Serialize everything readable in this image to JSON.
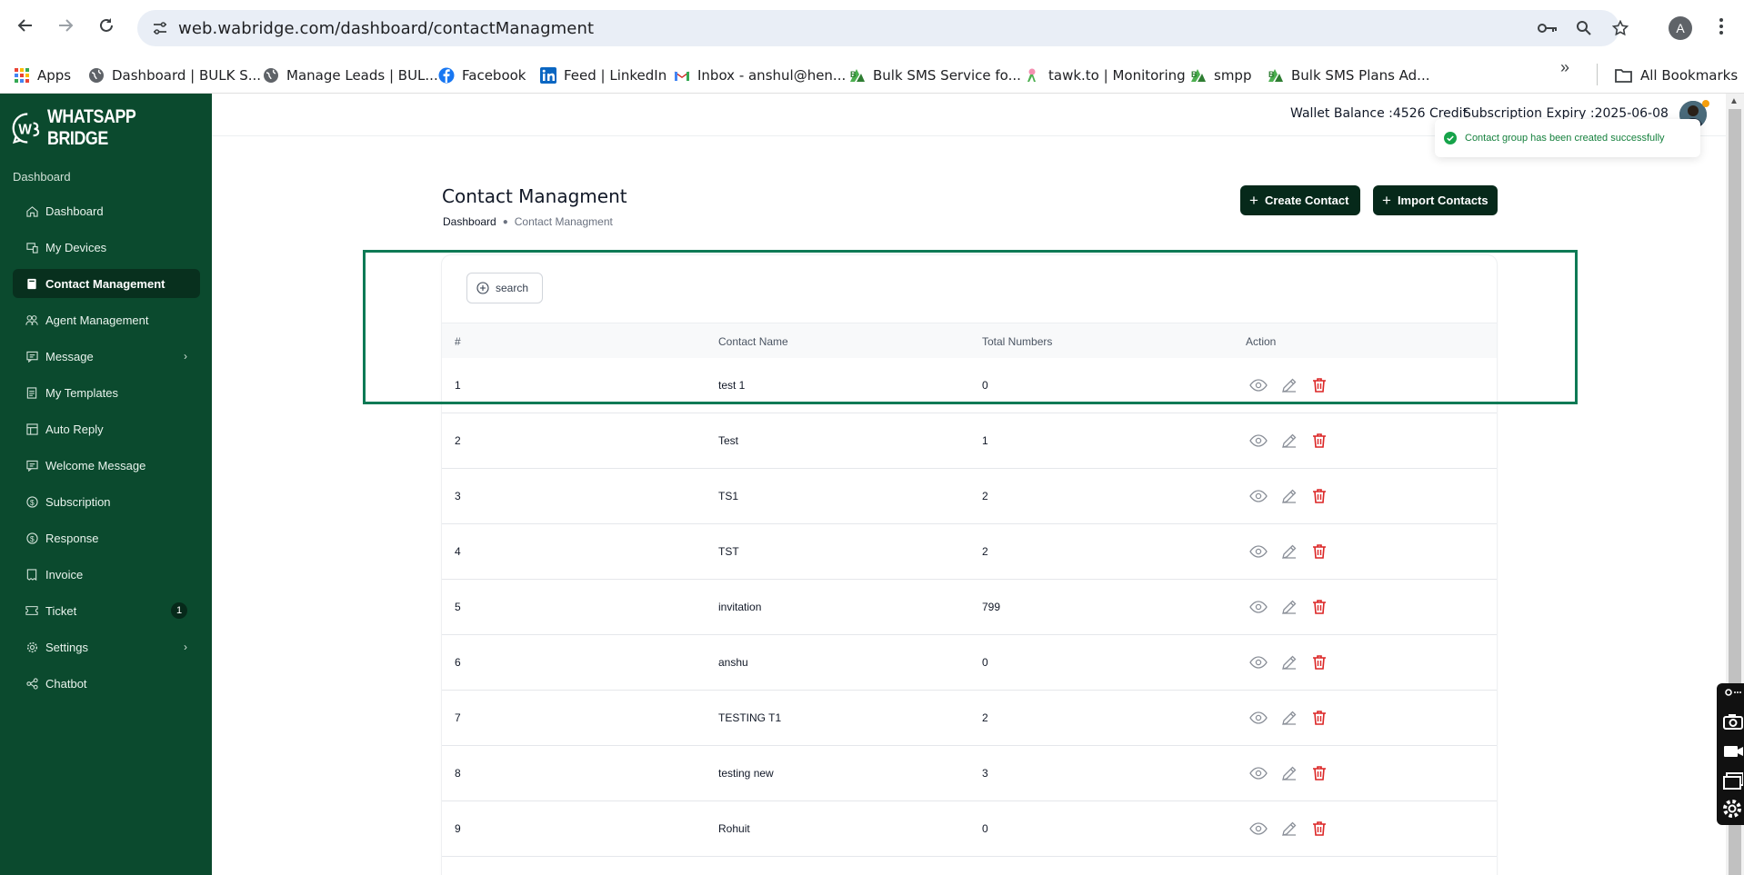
{
  "browser": {
    "url": "web.wabridge.com/dashboard/contactManagment",
    "profile_initial": "A",
    "bookmarks": [
      {
        "label": "Apps",
        "icon": "apps-grid-icon"
      },
      {
        "label": "Dashboard | BULK S...",
        "icon": "globe-icon"
      },
      {
        "label": "Manage Leads | BUL...",
        "icon": "globe-icon"
      },
      {
        "label": "Facebook",
        "icon": "facebook-icon"
      },
      {
        "label": "Feed | LinkedIn",
        "icon": "linkedin-icon"
      },
      {
        "label": "Inbox - anshul@hen...",
        "icon": "gmail-icon"
      },
      {
        "label": "Bulk SMS Service fo...",
        "icon": "brand-b-icon"
      },
      {
        "label": "tawk.to | Monitoring",
        "icon": "tawk-icon"
      },
      {
        "label": "smpp",
        "icon": "brand-b-icon"
      },
      {
        "label": "Bulk SMS Plans Ad...",
        "icon": "brand-b-icon"
      }
    ],
    "all_bookmarks": "All Bookmarks"
  },
  "sidebar": {
    "logo_text": "WHATSAPP BRIDGE",
    "section": "Dashboard",
    "items": [
      {
        "label": "Dashboard",
        "icon": "home-icon"
      },
      {
        "label": "My Devices",
        "icon": "devices-icon"
      },
      {
        "label": "Contact Management",
        "icon": "contact-book-icon",
        "active": true
      },
      {
        "label": "Agent Management",
        "icon": "agents-icon"
      },
      {
        "label": "Message",
        "icon": "message-icon",
        "chevron": true
      },
      {
        "label": "My Templates",
        "icon": "template-icon"
      },
      {
        "label": "Auto Reply",
        "icon": "auto-reply-icon"
      },
      {
        "label": "Welcome Message",
        "icon": "welcome-icon"
      },
      {
        "label": "Subscription",
        "icon": "dollar-icon"
      },
      {
        "label": "Response",
        "icon": "dollar-icon"
      },
      {
        "label": "Invoice",
        "icon": "invoice-icon"
      },
      {
        "label": "Ticket",
        "icon": "ticket-icon",
        "badge": "1"
      },
      {
        "label": "Settings",
        "icon": "gear-icon",
        "chevron": true
      },
      {
        "label": "Chatbot",
        "icon": "chatbot-icon"
      }
    ]
  },
  "topbar": {
    "wallet_label": "Wallet Balance :",
    "wallet_value": "4526 Credit",
    "subscription_label": "Subscription Expiry :",
    "subscription_value": "2025-06-08"
  },
  "toast": {
    "message": "Contact group has been created successfully",
    "color": "#15803d"
  },
  "page": {
    "title": "Contact Managment",
    "breadcrumb_home": "Dashboard",
    "breadcrumb_current": "Contact Managment",
    "create_button": "Create Contact",
    "import_button": "Import Contacts",
    "search_button": "search"
  },
  "table": {
    "columns": [
      "#",
      "Contact Name",
      "Total Numbers",
      "Action"
    ],
    "rows": [
      {
        "num": "1",
        "name": "test 1",
        "total": "0"
      },
      {
        "num": "2",
        "name": "Test",
        "total": "1"
      },
      {
        "num": "3",
        "name": "TS1",
        "total": "2"
      },
      {
        "num": "4",
        "name": "TST",
        "total": "2"
      },
      {
        "num": "5",
        "name": "invitation",
        "total": "799"
      },
      {
        "num": "6",
        "name": "anshu",
        "total": "0"
      },
      {
        "num": "7",
        "name": "TESTING T1",
        "total": "2"
      },
      {
        "num": "8",
        "name": "testing new",
        "total": "3"
      },
      {
        "num": "9",
        "name": "Rohuit",
        "total": "0"
      }
    ]
  },
  "colors": {
    "sidebar_bg": "#0b4a2e",
    "primary_dark": "#06291a",
    "highlight_border": "#0e7a55",
    "delete_red": "#dc2626"
  }
}
